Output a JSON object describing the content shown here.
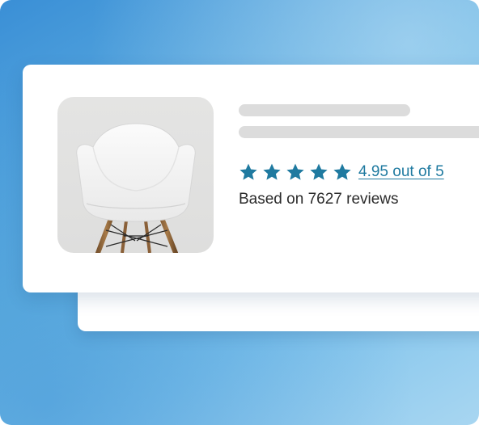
{
  "colors": {
    "accent": "#1f7aa0",
    "star": "#1f7aa0",
    "skeleton": "#dcdcdc",
    "background_gradient_start": "#3a8fd6",
    "background_gradient_end": "#a8d6f1",
    "text": "#2b2b2b"
  },
  "product": {
    "image_icon": "white-chair-photo",
    "rating": {
      "stars_filled": 5,
      "stars_total": 5,
      "star_icon": "star-icon",
      "link_text": "4.95 out of 5"
    },
    "review_count_text": "Based on 7627 reviews"
  }
}
